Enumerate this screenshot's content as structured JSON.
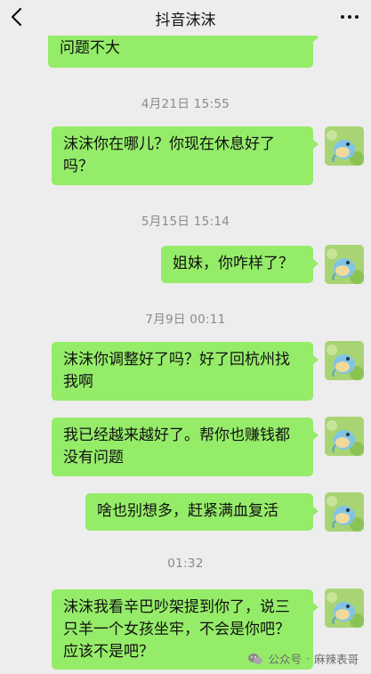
{
  "header": {
    "title": "抖音沫沫",
    "back_icon": "chevron-left-icon",
    "more_icon": "more-dots-icon"
  },
  "messages": [
    {
      "type": "bubble",
      "text": "问题不大"
    },
    {
      "type": "time",
      "text": "4月21日 15:55"
    },
    {
      "type": "bubble",
      "text": "沫沫你在哪儿？你现在休息好了吗？"
    },
    {
      "type": "time",
      "text": "5月15日 15:14"
    },
    {
      "type": "bubble",
      "text": "姐妹，你咋样了？"
    },
    {
      "type": "time",
      "text": "7月9日 00:11"
    },
    {
      "type": "bubble",
      "text": "沫沫你调整好了吗？好了回杭州找我啊"
    },
    {
      "type": "bubble",
      "text": "我已经越来越好了。帮你也赚钱都没有问题"
    },
    {
      "type": "bubble",
      "text": "啥也别想多，赶紧满血复活"
    },
    {
      "type": "time",
      "text": "01:32"
    },
    {
      "type": "bubble",
      "text": "沫沫我看辛巴吵架提到你了，说三只羊一个女孩坐牢，不会是你吧？应该不是吧？"
    }
  ],
  "watermark": {
    "prefix": "公众号",
    "separator": "·",
    "name": "麻辣表哥",
    "icon": "wechat-icon"
  },
  "colors": {
    "background": "#ededed",
    "bubble": "#95ec69",
    "timestamp_text": "#8a8a8a"
  }
}
